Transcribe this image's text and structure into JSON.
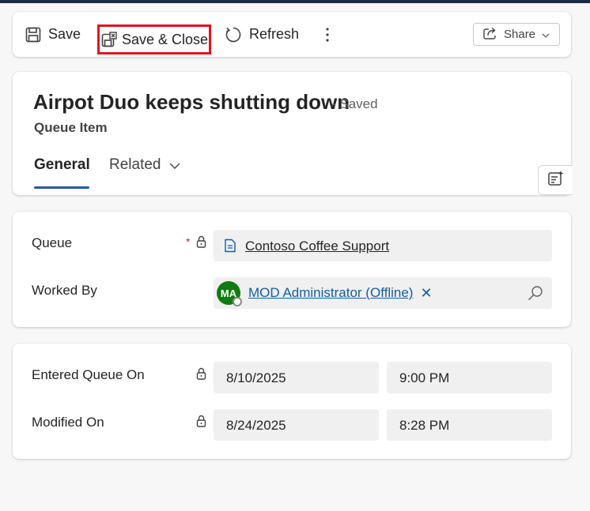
{
  "toolbar": {
    "save_label": "Save",
    "save_close_label": "Save & Close",
    "refresh_label": "Refresh",
    "share_label": "Share"
  },
  "header": {
    "title": "Airpot Duo keeps shutting down",
    "status": "- Saved",
    "entity": "Queue Item",
    "tabs": [
      {
        "label": "General",
        "selected": true
      },
      {
        "label": "Related",
        "selected": false
      }
    ]
  },
  "section_queue": {
    "queue_label": "Queue",
    "queue_required": "*",
    "queue_value": "Contoso Coffee Support",
    "worked_by_label": "Worked By",
    "worked_by_initials": "MA",
    "worked_by_value": "MOD Administrator (Offline)",
    "worked_by_remove": "✕"
  },
  "section_dates": {
    "entered_label": "Entered Queue On",
    "entered_date": "8/10/2025",
    "entered_time": "9:00 PM",
    "modified_label": "Modified On",
    "modified_date": "8/24/2025",
    "modified_time": "8:28 PM"
  },
  "colors": {
    "accent": "#1f5ba6",
    "link": "#115ea3",
    "highlight_box": "#e0141e",
    "avatar": "#107c10",
    "top_bar": "#1c2b45"
  },
  "icons": [
    "save-icon",
    "save-close-icon",
    "refresh-icon",
    "more-vertical-icon",
    "share-icon",
    "chevron-down-icon",
    "copilot-icon",
    "lock-icon",
    "entity-icon",
    "search-icon"
  ]
}
